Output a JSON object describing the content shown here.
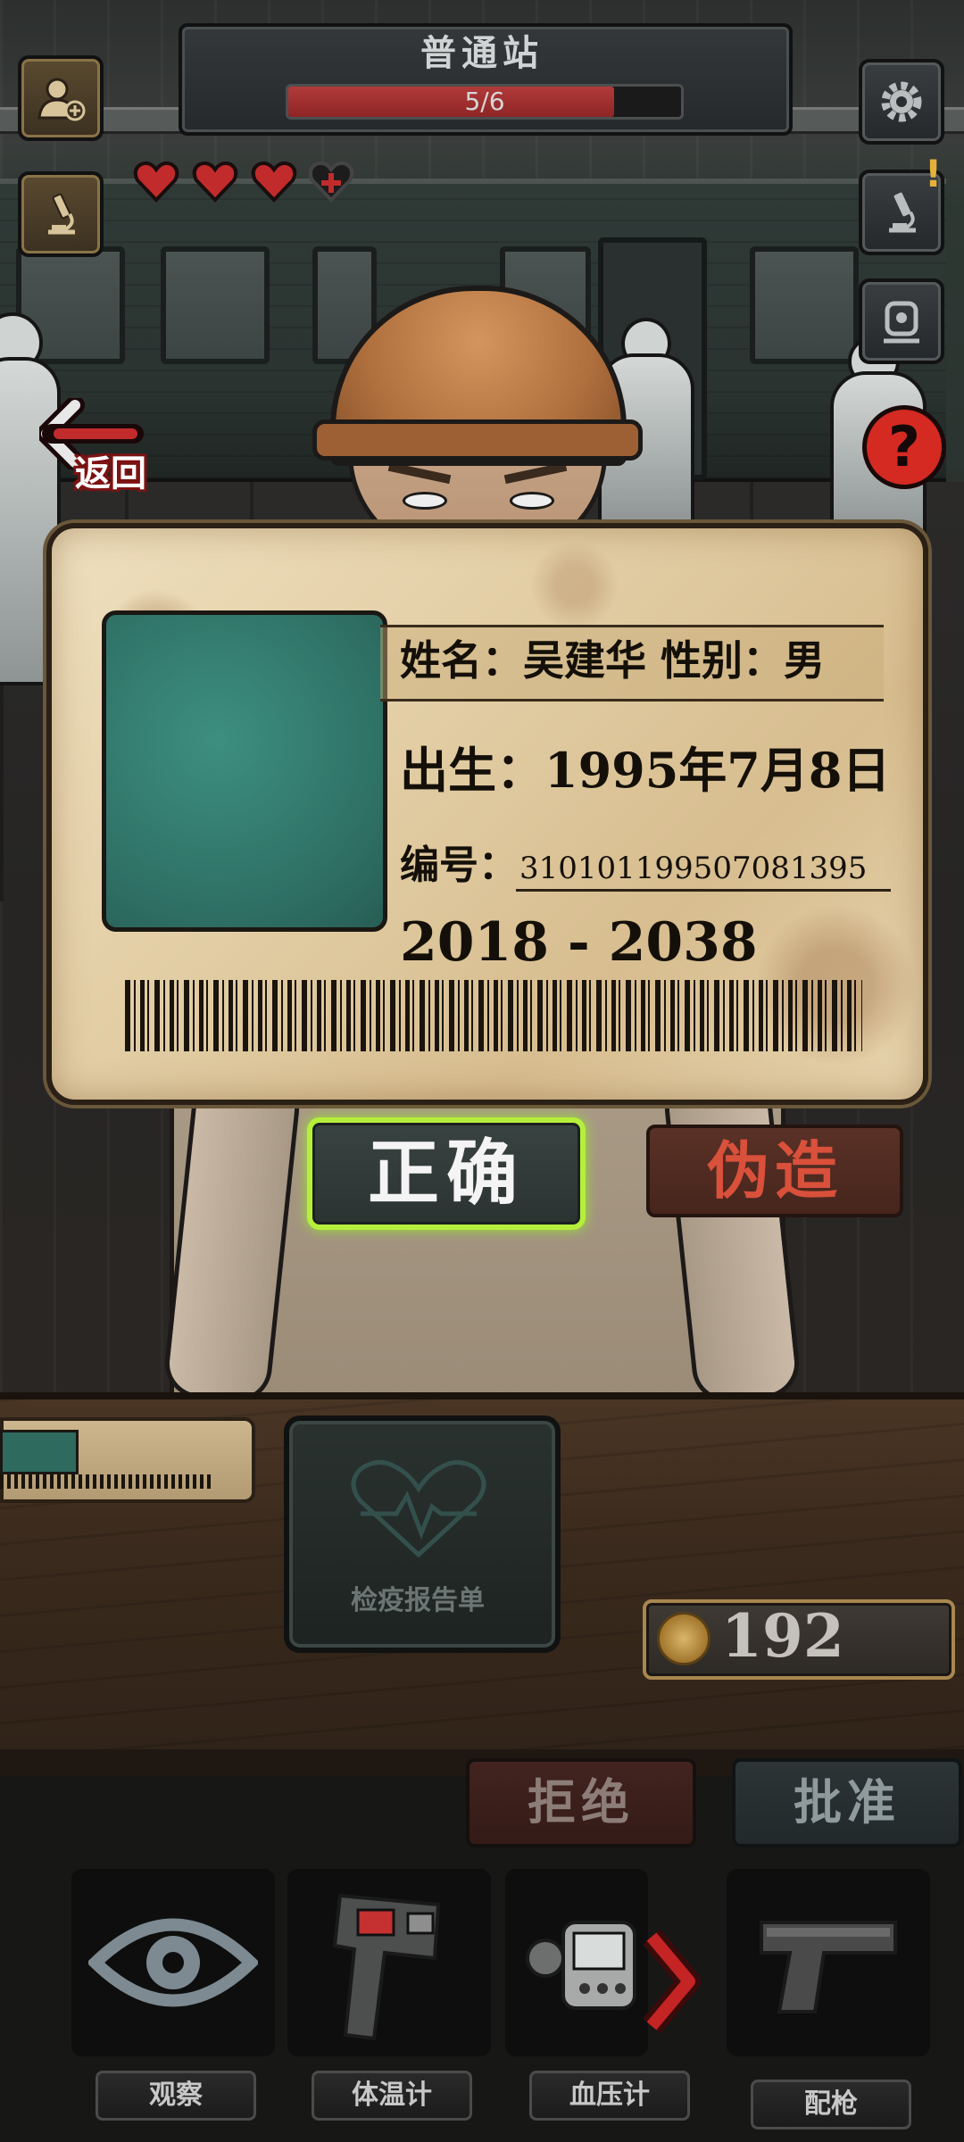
{
  "header": {
    "station_name": "普通站",
    "progress_text": "5/6",
    "progress_fraction": 0.83,
    "hearts_filled": 3,
    "hearts_total": 4
  },
  "nav": {
    "back_label": "返回"
  },
  "id_card": {
    "name_line": "姓名：吴建华  性别：男",
    "birth_line": "出生：1995年7月8日",
    "number_label": "编号：",
    "number_value": "310101199507081395",
    "validity": "2018 - 2038"
  },
  "verdict": {
    "correct_label": "正确",
    "forged_label": "伪造"
  },
  "desk": {
    "report_label": "检疫报告单",
    "coins": "192"
  },
  "decision": {
    "reject_label": "拒绝",
    "approve_label": "批准"
  },
  "tools": [
    {
      "label": "观察",
      "icon": "eye-icon"
    },
    {
      "label": "体温计",
      "icon": "thermometer-gun-icon"
    },
    {
      "label": "血压计",
      "icon": "blood-pressure-monitor-icon"
    },
    {
      "label": "配枪",
      "icon": "pistol-icon"
    }
  ],
  "colors": {
    "accent_green": "#b6ef3b",
    "forged_red": "#d9503b",
    "heart_red": "#c22b2b",
    "id_photo_teal": "#2e6f64"
  }
}
